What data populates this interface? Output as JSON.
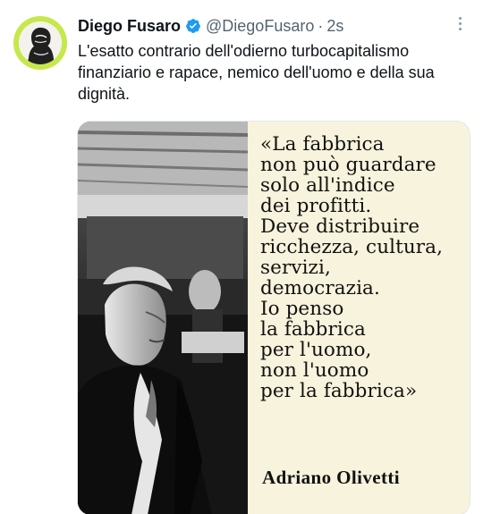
{
  "tweet": {
    "author_name": "Diego Fusaro",
    "handle": "@DiegoFusaro",
    "separator": "·",
    "time": "2s",
    "text": "L'esatto contrario dell'odierno turbocapitalismo finanziario e rapace, nemico dell'uomo e della sua dignità.",
    "verified_icon": "verified-badge-icon",
    "more_icon": "more-options-icon"
  },
  "media": {
    "quote": "«La fabbrica\nnon può guardare\nsolo all'indice\ndei profitti.\nDeve distribuire\nricchezza, cultura,\nservizi,\ndemocrazia.\nIo penso\nla fabbrica\nper l'uomo,\nnon l'uomo\nper la fabbrica»",
    "author": "Adriano  Olivetti"
  },
  "colors": {
    "avatar_ring": "#c6e84a",
    "verified": "#1d9bf0",
    "text": "#0f1419",
    "muted": "#536471",
    "quote_background": "#f8f3dc"
  }
}
